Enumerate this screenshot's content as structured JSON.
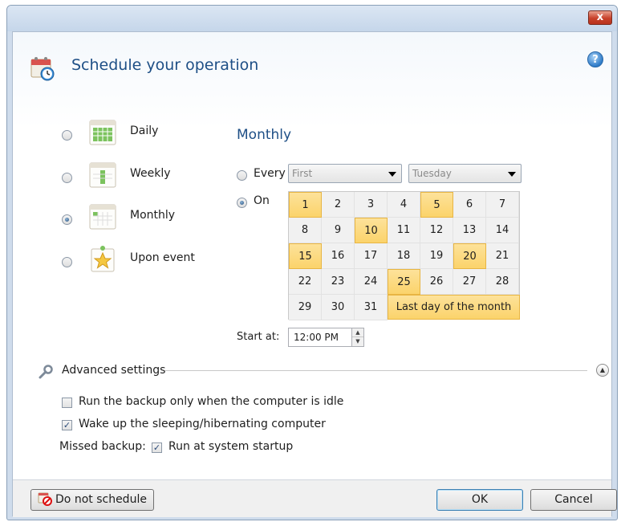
{
  "window": {
    "close_glyph": "x"
  },
  "header": {
    "title": "Schedule your operation",
    "icon": "calendar-clock-icon",
    "help_glyph": "?"
  },
  "frequency": {
    "options": [
      {
        "label": "Daily",
        "checked": false,
        "icon": "daily-calendar-icon"
      },
      {
        "label": "Weekly",
        "checked": false,
        "icon": "weekly-calendar-icon"
      },
      {
        "label": "Monthly",
        "checked": true,
        "icon": "monthly-calendar-icon"
      },
      {
        "label": "Upon event",
        "checked": false,
        "icon": "star-event-icon"
      }
    ]
  },
  "monthly": {
    "heading": "Monthly",
    "every_label": "Every",
    "every_checked": false,
    "week_select": "First",
    "day_select": "Tuesday",
    "on_label": "On",
    "on_checked": true,
    "days": [
      "1",
      "2",
      "3",
      "4",
      "5",
      "6",
      "7",
      "8",
      "9",
      "10",
      "11",
      "12",
      "13",
      "14",
      "15",
      "16",
      "17",
      "18",
      "19",
      "20",
      "21",
      "22",
      "23",
      "24",
      "25",
      "26",
      "27",
      "28",
      "29",
      "30",
      "31"
    ],
    "selected_days": [
      1,
      5,
      10,
      15,
      20,
      25
    ],
    "last_day_label": "Last day of the month",
    "last_day_selected": true
  },
  "start": {
    "label": "Start at:",
    "value": "12:00 PM"
  },
  "advanced": {
    "label": "Advanced settings",
    "idle_label": "Run the backup only when the computer is idle",
    "idle_checked": false,
    "wake_label": "Wake up the sleeping/hibernating computer",
    "wake_checked": true,
    "missed_label": "Missed backup:",
    "startup_label": "Run at system startup",
    "startup_checked": true
  },
  "footer": {
    "no_schedule_label": "Do not schedule",
    "ok_label": "OK",
    "cancel_label": "Cancel"
  },
  "colors": {
    "accent": "#1e4f86",
    "selected_day": "#fbd36b",
    "selected_border": "#e8b543"
  }
}
